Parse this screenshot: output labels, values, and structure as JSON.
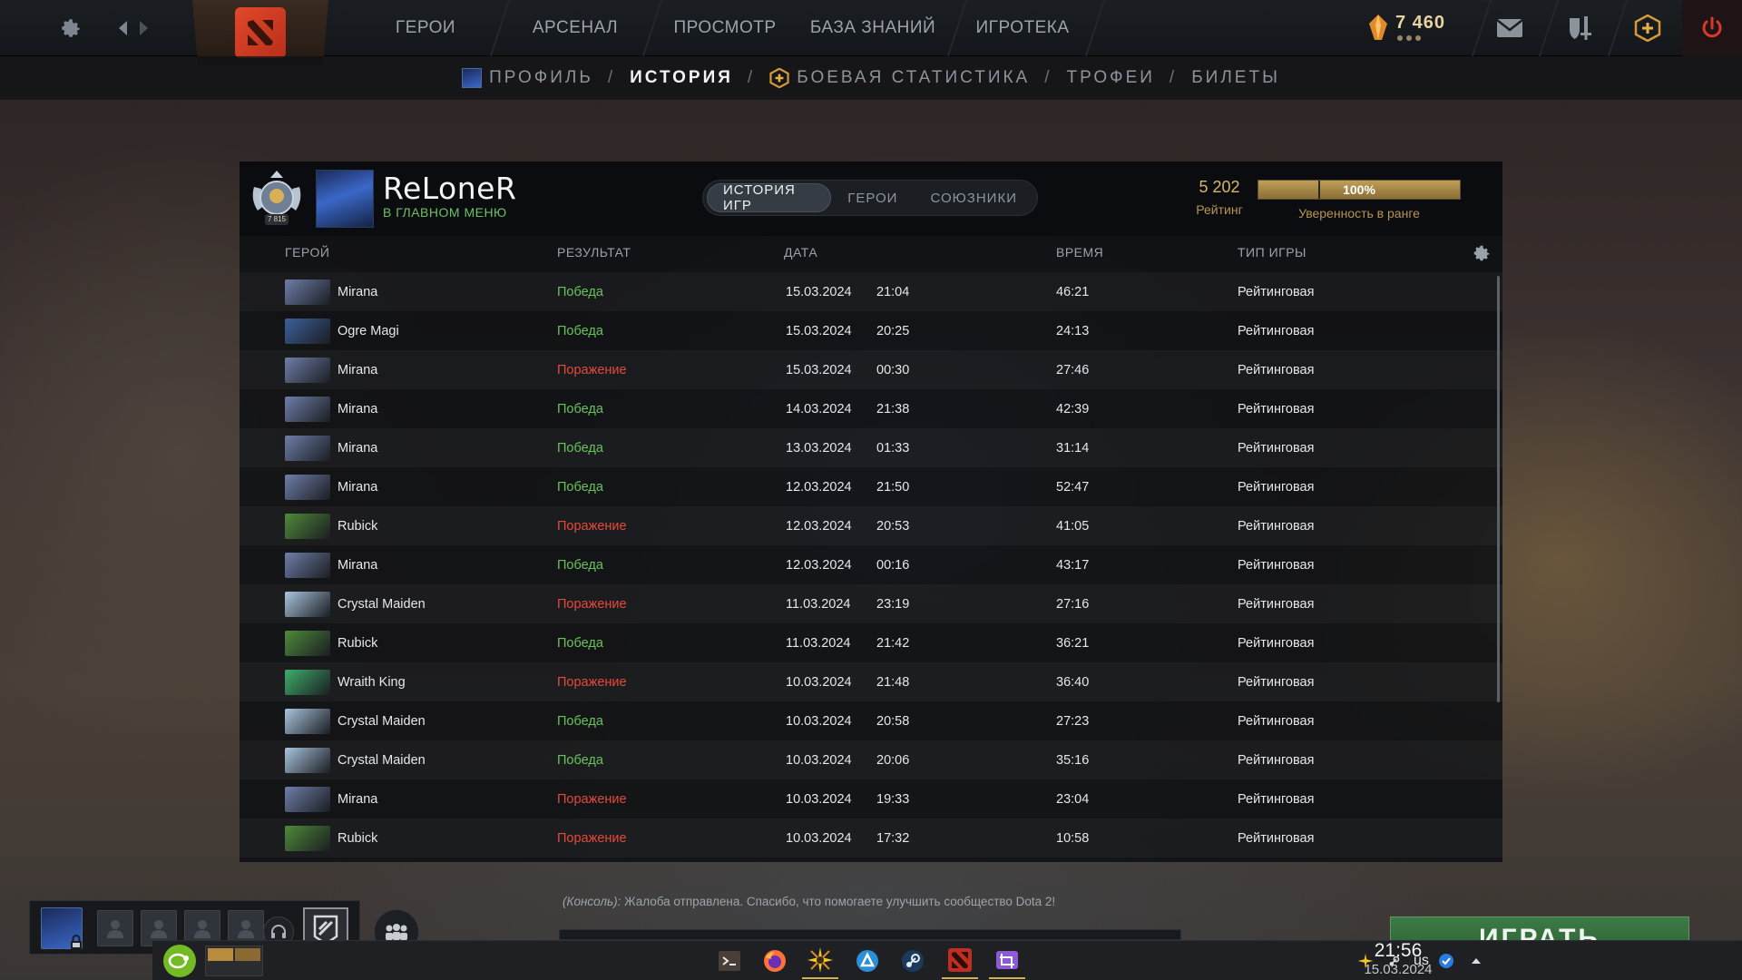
{
  "topnav": {
    "items": [
      "ГЕРОИ",
      "АРСЕНАЛ",
      "ПРОСМОТР",
      "БАЗА ЗНАНИЙ",
      "ИГРОТЕКА"
    ],
    "currency_value": "7 460"
  },
  "subnav": {
    "items": [
      {
        "label": "ПРОФИЛЬ"
      },
      {
        "label": "ИСТОРИЯ"
      },
      {
        "label": "БОЕВАЯ СТАТИСТИКА"
      },
      {
        "label": "ТРОФЕИ"
      },
      {
        "label": "БИЛЕТЫ"
      }
    ],
    "active": "ИСТОРИЯ",
    "separator": "/"
  },
  "profile": {
    "medal_text": "7 815",
    "username": "ReLoneR",
    "status": "В ГЛАВНОМ МЕНЮ",
    "tabs": [
      "ИСТОРИЯ ИГР",
      "ГЕРОИ",
      "СОЮЗНИКИ"
    ],
    "rating_value": "5 202",
    "rating_label": "Рейтинг",
    "confidence_value": "100%",
    "confidence_fraction": 1.0,
    "confidence_label": "Уверенность в ранге"
  },
  "table": {
    "columns": [
      "ГЕРОЙ",
      "РЕЗУЛЬТАТ",
      "ДАТА",
      "ВРЕМЯ",
      "ТИП ИГРЫ"
    ],
    "rows": [
      {
        "hero": "Mirana",
        "result": "Победа",
        "win": true,
        "date": "15.03.2024",
        "time": "21:04",
        "duration": "46:21",
        "type": "Рейтинговая"
      },
      {
        "hero": "Ogre Magi",
        "result": "Победа",
        "win": true,
        "date": "15.03.2024",
        "time": "20:25",
        "duration": "24:13",
        "type": "Рейтинговая"
      },
      {
        "hero": "Mirana",
        "result": "Поражение",
        "win": false,
        "date": "15.03.2024",
        "time": "00:30",
        "duration": "27:46",
        "type": "Рейтинговая"
      },
      {
        "hero": "Mirana",
        "result": "Победа",
        "win": true,
        "date": "14.03.2024",
        "time": "21:38",
        "duration": "42:39",
        "type": "Рейтинговая"
      },
      {
        "hero": "Mirana",
        "result": "Победа",
        "win": true,
        "date": "13.03.2024",
        "time": "01:33",
        "duration": "31:14",
        "type": "Рейтинговая"
      },
      {
        "hero": "Mirana",
        "result": "Победа",
        "win": true,
        "date": "12.03.2024",
        "time": "21:50",
        "duration": "52:47",
        "type": "Рейтинговая"
      },
      {
        "hero": "Rubick",
        "result": "Поражение",
        "win": false,
        "date": "12.03.2024",
        "time": "20:53",
        "duration": "41:05",
        "type": "Рейтинговая"
      },
      {
        "hero": "Mirana",
        "result": "Победа",
        "win": true,
        "date": "12.03.2024",
        "time": "00:16",
        "duration": "43:17",
        "type": "Рейтинговая"
      },
      {
        "hero": "Crystal Maiden",
        "result": "Поражение",
        "win": false,
        "date": "11.03.2024",
        "time": "23:19",
        "duration": "27:16",
        "type": "Рейтинговая"
      },
      {
        "hero": "Rubick",
        "result": "Победа",
        "win": true,
        "date": "11.03.2024",
        "time": "21:42",
        "duration": "36:21",
        "type": "Рейтинговая"
      },
      {
        "hero": "Wraith King",
        "result": "Поражение",
        "win": false,
        "date": "10.03.2024",
        "time": "21:48",
        "duration": "36:40",
        "type": "Рейтинговая"
      },
      {
        "hero": "Crystal Maiden",
        "result": "Победа",
        "win": true,
        "date": "10.03.2024",
        "time": "20:58",
        "duration": "27:23",
        "type": "Рейтинговая"
      },
      {
        "hero": "Crystal Maiden",
        "result": "Победа",
        "win": true,
        "date": "10.03.2024",
        "time": "20:06",
        "duration": "35:16",
        "type": "Рейтинговая"
      },
      {
        "hero": "Mirana",
        "result": "Поражение",
        "win": false,
        "date": "10.03.2024",
        "time": "19:33",
        "duration": "23:04",
        "type": "Рейтинговая"
      },
      {
        "hero": "Rubick",
        "result": "Поражение",
        "win": false,
        "date": "10.03.2024",
        "time": "17:32",
        "duration": "10:58",
        "type": "Рейтинговая"
      }
    ]
  },
  "hero_colors": {
    "Mirana": "#6f7ea8",
    "Ogre Magi": "#3d5f9c",
    "Rubick": "#4f8a3a",
    "Crystal Maiden": "#a9c4dd",
    "Wraith King": "#3fae6a"
  },
  "chat": {
    "prefix": "(Консоль):",
    "message": "Жалоба отправлена. Спасибо, что помогаете улучшить сообщество Dota 2!"
  },
  "play_button": "ИГРАТЬ",
  "taskbar": {
    "layout": "us",
    "time": "21:56",
    "date": "15.03.2024"
  },
  "colors": {
    "win": "#69c25c",
    "loss": "#e34a3a",
    "gold": "#d9b56a"
  }
}
